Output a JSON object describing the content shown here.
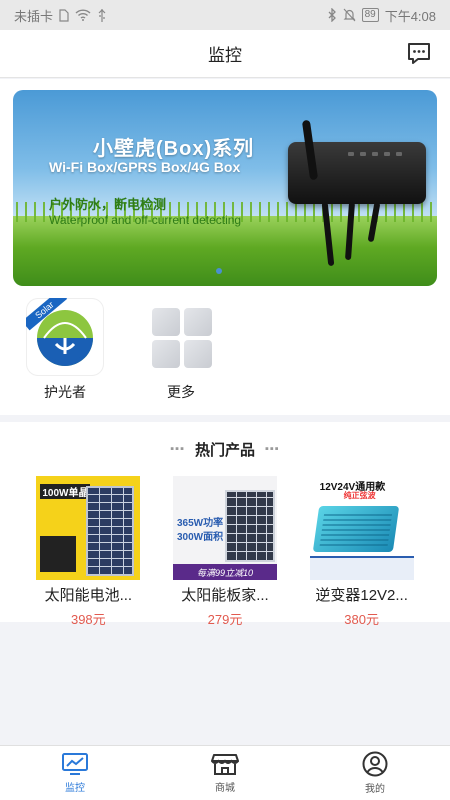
{
  "status_bar": {
    "carrier": "未插卡",
    "battery": "89",
    "time": "下午4:08"
  },
  "header": {
    "title": "监控",
    "message_icon": "message-bubble-icon"
  },
  "banner": {
    "title": "小壁虎(Box)系列",
    "subtitle": "Wi-Fi Box/GPRS Box/4G Box",
    "feature_cn": "户外防水，断电检测",
    "feature_en": "Waterproof and off-current detecting"
  },
  "apps": [
    {
      "label": "护光者",
      "icon": "solar-app-icon",
      "badge": "Solar"
    },
    {
      "label": "更多",
      "icon": "more-grid-icon"
    }
  ],
  "hot_products": {
    "title": "热门产品",
    "items": [
      {
        "name": "太阳能电池...",
        "price": "398元",
        "img_text": "100W单晶"
      },
      {
        "name": "太阳能板家...",
        "price": "279元",
        "img_text_1": "365W功率",
        "img_text_2": "300W面积",
        "img_footer": "每满99立减10"
      },
      {
        "name": "逆变器12V2...",
        "price": "380元",
        "img_text": "12V24V通用款",
        "img_sub": "纯正弦波"
      }
    ]
  },
  "tabbar": [
    {
      "label": "监控",
      "icon": "monitor-icon",
      "active": true
    },
    {
      "label": "商城",
      "icon": "store-icon",
      "active": false
    },
    {
      "label": "我的",
      "icon": "profile-icon",
      "active": false
    }
  ],
  "colors": {
    "accent": "#2a79d9",
    "price": "#e25a4f",
    "background": "#f2f3f7"
  }
}
